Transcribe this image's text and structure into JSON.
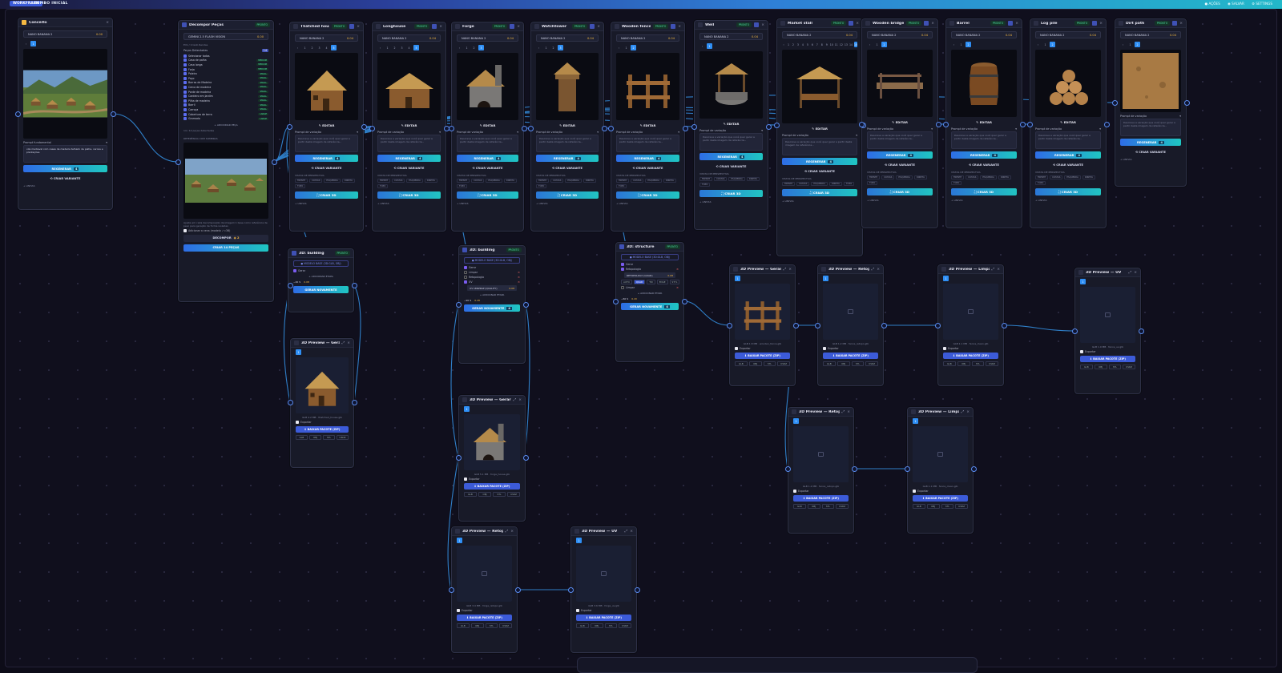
{
  "topbar": {
    "brand": "WORKFRAME",
    "title": "COMBO INICIAL",
    "right": [
      "● AÇÕES",
      "◉ SALVAR",
      "⚙ SETTINGS"
    ]
  },
  "colors": {
    "accent": "#2f8ff5",
    "gradient_start": "#2e6de6",
    "gradient_end": "#1fc6c2",
    "cost": "#f5b942",
    "status": "#4be0a0"
  },
  "common": {
    "model": "NANO BANANA 2",
    "edit": "✎ EDITAR",
    "prompt_label": "Prompt de variação",
    "prompt_placeholder": "Descreva a variação que você quer gerar a partir desta imagem de referência...",
    "regen": "REGENERAR",
    "create_variant": "⟲ CRIAR VARIANTE",
    "vp_label": "VISTAS DE PERSPECTIVA",
    "vp_tags": [
      "FRENTE",
      "COSTAS",
      "ESQUERDA",
      "DIREITA",
      "TOPO"
    ],
    "create_3d": "⛶ CRIAR 3D",
    "lineage": "+ LINHAS",
    "download": "⬇ BAIXAR PACOTE (ZIP)",
    "export": "Exportar",
    "formats": [
      "GLB",
      "OBJ",
      "STL",
      "USDZ"
    ],
    "add_step": "+ ADICIONAR ETAPA",
    "generate_again": "GERAR NOVAMENTE",
    "status": "PRONTO",
    "credit": "4"
  },
  "concept": {
    "title": "Conceito",
    "model": "NANO BANANA 2",
    "cost": "0.00",
    "prompt_label": "Prompt fundamental",
    "prompt": "vila medieval com casas de madeira telhado de palha, cercas e plantações",
    "regen": "REGENERAR",
    "create_variant": "⟲ CRIAR VARIANTE",
    "lineage": "+ LINHAS"
  },
  "decompose": {
    "title": "Decompor Peças",
    "model": "GEMINI 2.5 FLASH VISION",
    "cost": "0.00",
    "info": "Elm / Criado Rendas",
    "detected_label": "Peças Detectadas",
    "select_all": "Selecionar todos",
    "items": [
      "Casa de palha",
      "Casa longa",
      "Forja",
      "Poleiro",
      "Poço",
      "Barras de Madeira",
      "Cerca de madeira",
      "Ponte de madeira",
      "Cardeiro em Jardim",
      "Pilha de madeira",
      "Barril",
      "Carroça",
      "Cobertura de terra",
      "Gramado"
    ],
    "add_piece": "+ ADICIONAR PEÇA",
    "generated_note": "14 / 14 peças detectadas",
    "ref_label": "REFERÊNCIA COM SOMBRAS",
    "ref_note": "Ajuste em cada decomposição da imagem 1 base como referência de peso para geração de forma isoladas",
    "checkbox": "Adicionar a cena (modelo ✓=36)",
    "decompose_btn": "DECOMPOR",
    "create_btn": "CRIAR 14 PEÇAS"
  },
  "pieces": [
    {
      "title": "Thatched house",
      "pages": [
        "1",
        "2",
        "3",
        "4",
        "5"
      ]
    },
    {
      "title": "Longhouse",
      "pages": [
        "1",
        "2",
        "3",
        "4",
        "5"
      ]
    },
    {
      "title": "Forge",
      "pages": [
        "1",
        "2",
        "3"
      ]
    },
    {
      "title": "Watchtower",
      "pages": [
        "1",
        "2",
        "3"
      ]
    },
    {
      "title": "Wooden fence",
      "pages": [
        "1",
        "2"
      ]
    },
    {
      "title": "Well",
      "pages": [
        "1"
      ]
    },
    {
      "title": "Market stall",
      "pages": [
        "1",
        "2",
        "3",
        "4",
        "5",
        "6",
        "7",
        "8",
        "9",
        "10",
        "11",
        "12",
        "13",
        "14",
        "15"
      ]
    },
    {
      "title": "Wooden bridge",
      "pages": [
        "1",
        "2"
      ]
    },
    {
      "title": "Barrel",
      "pages": [
        "1",
        "2"
      ]
    },
    {
      "title": "Log pile",
      "pages": [
        "1",
        "2"
      ]
    },
    {
      "title": "Dirt path",
      "pages": [
        "1",
        "2"
      ]
    }
  ],
  "gen3d": [
    {
      "title": "3D: building",
      "select": "● MODELO BASE (3D:GLB, OBJ)",
      "steps": [
        "Gerar"
      ],
      "cost": "0.08",
      "time": "~40 S",
      "meta": "CUSTO · 0,08 · 1 min · 3 de 2"
    },
    {
      "title": "3D: building",
      "select": "● MODELO BASE (3D:GLB, OBJ)",
      "steps": [
        "Gerar",
        "Limpar",
        "Retopologia",
        "UV"
      ],
      "option": "UV UNWRAP (QUALITY)",
      "option_cost": "0.08",
      "cost": "0.28",
      "time": "~90 S",
      "meta": "CUSTO · 0,28 · 3 min"
    },
    {
      "title": "3D: structure",
      "select": "● MODELO BASE (3D:GLB, OBJ)",
      "steps": [
        "Gerar",
        "Retopologia",
        "Limpar"
      ],
      "option": "RETOPOLOGY (QUAD)",
      "option_cost": "0.08",
      "cost": "0.20",
      "time": "~60 S",
      "tri_options": [
        "AUTO",
        "QUAD",
        "TRI",
        "EDGE",
        "STYL"
      ],
      "meta": "CUSTO · 0,20 · 2 min"
    }
  ],
  "previews": {
    "gerar_house": {
      "title": "3D Preview — Gerar",
      "meta": "GLB 4.2 MB · thatched_house.glb"
    },
    "gerar_forge": {
      "title": "3D Preview — Gerar",
      "meta": "GLB 5.1 MB · forge_house.glb"
    },
    "retopo_forge": {
      "title": "3D Preview — Retopologia",
      "meta": "GLB 3.4 MB · forge_retopo.glb"
    },
    "uv_forge": {
      "title": "3D Preview — UV",
      "meta": "GLB 3.6 MB · forge_uv.glb"
    },
    "gerar_fence": {
      "title": "3D Preview — Gerar",
      "meta": "GLB 1.8 MB · wooden_fence.glb"
    },
    "retopo_fence_top": {
      "title": "3D Preview — Retopologia",
      "meta": "GLB 1.2 MB · fence_retopo.glb"
    },
    "limpar_fence_top": {
      "title": "3D Preview — Limpar",
      "meta": "GLB 1.1 MB · fence_clean.glb"
    },
    "uv_fence": {
      "title": "3D Preview — UV",
      "meta": "GLB 1.0 MB · fence_uv.glb"
    },
    "retopo_fence": {
      "title": "3D Preview — Retopologia",
      "meta": "GLB 1.2 MB · fence_retopo.glb"
    },
    "limpar_fence": {
      "title": "3D Preview — Limpar",
      "meta": "GLB 1.1 MB · fence_clean.glb"
    }
  }
}
